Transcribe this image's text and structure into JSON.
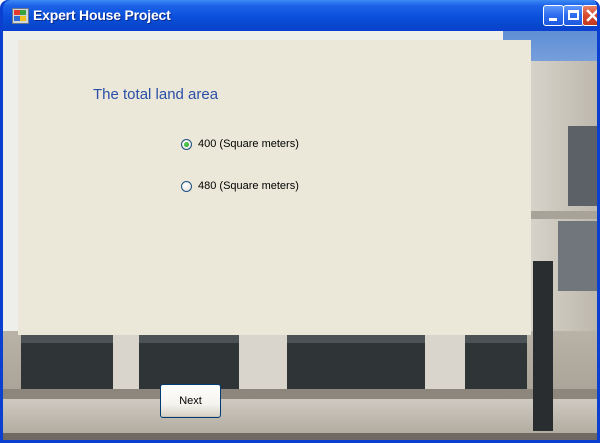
{
  "window": {
    "title": "Expert House Project",
    "icon": "app-icon",
    "controls": [
      "minimize-icon",
      "maximize-icon",
      "close-icon"
    ]
  },
  "form": {
    "question": "The total land  area",
    "options": [
      {
        "label": "400 (Square meters)",
        "selected": true
      },
      {
        "label": "480 (Square meters)",
        "selected": false
      }
    ],
    "next_label": "Next"
  },
  "colors": {
    "title_bar": "#0a4fdb",
    "panel": "#ebe8da",
    "question_text": "#2b4fa6",
    "close_button": "#d8492e",
    "radio_dot": "#1f9a1f"
  }
}
